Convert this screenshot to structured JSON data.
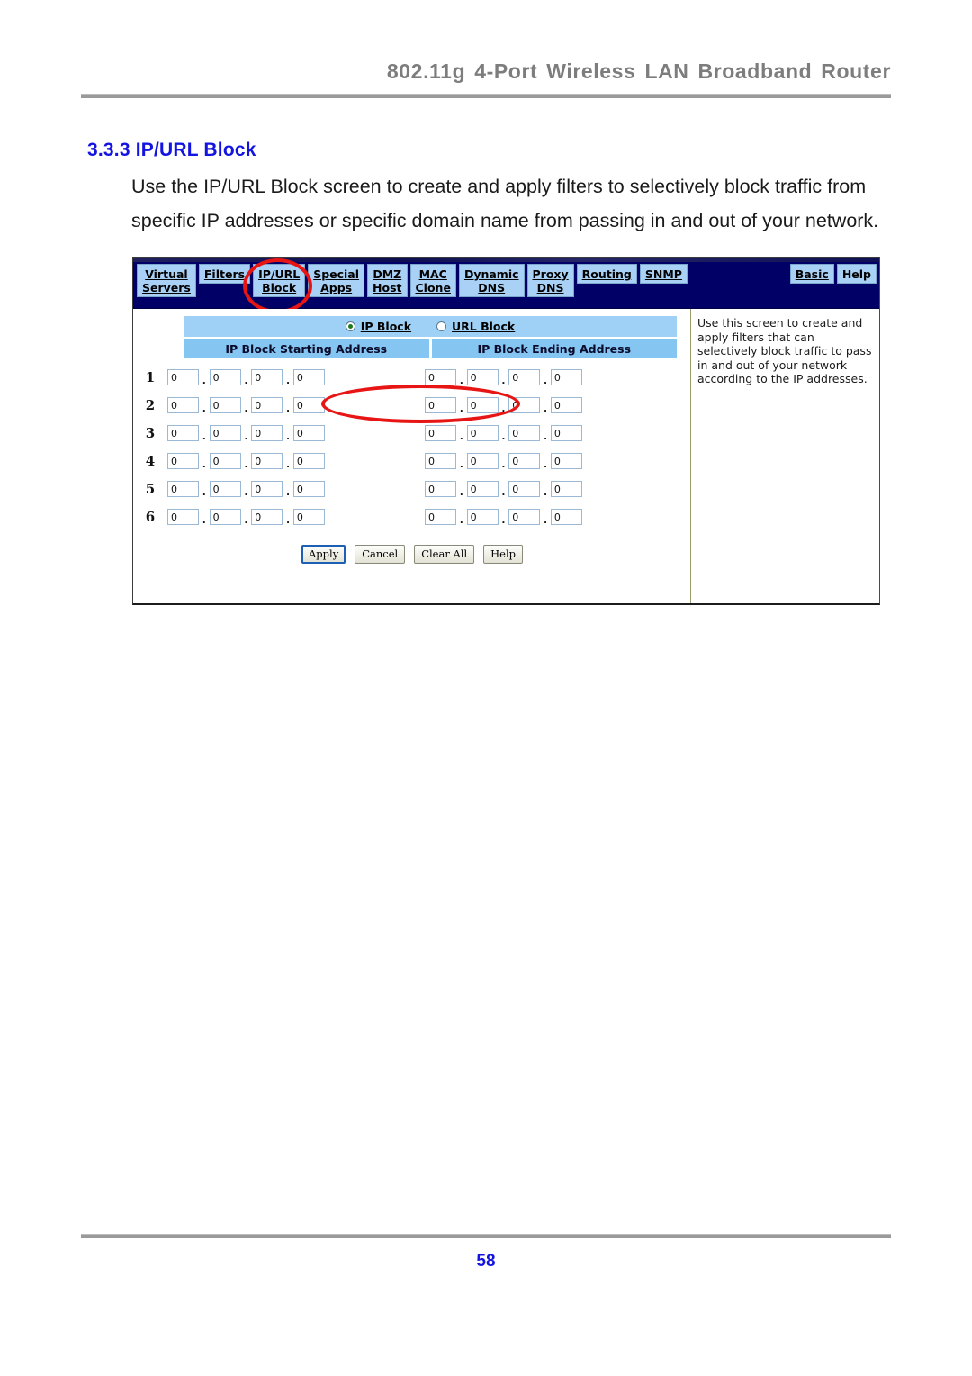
{
  "document": {
    "running_header": "802.11g 4-Port Wireless LAN Broadband Router",
    "section_number_title": "3.3.3 IP/URL Block",
    "body_paragraph": "Use the IP/URL Block screen to create and apply filters to selectively block traffic from specific IP addresses or specific domain name from passing in and out of your network.",
    "page_number": "58"
  },
  "screenshot": {
    "navbar": {
      "tabs": [
        {
          "id": "virtual-servers",
          "line1": "Virtual",
          "line2": "Servers"
        },
        {
          "id": "filters",
          "line1": "Filters",
          "line2": ""
        },
        {
          "id": "ip-url-block",
          "line1": "IP/URL",
          "line2": "Block"
        },
        {
          "id": "special-apps",
          "line1": "Special",
          "line2": "Apps"
        },
        {
          "id": "dmz-host",
          "line1": "DMZ",
          "line2": "Host"
        },
        {
          "id": "mac-clone",
          "line1": "MAC",
          "line2": "Clone"
        },
        {
          "id": "dynamic-dns",
          "line1": "Dynamic",
          "line2": "DNS"
        },
        {
          "id": "proxy-dns",
          "line1": "Proxy",
          "line2": "DNS"
        },
        {
          "id": "routing",
          "line1": "Routing",
          "line2": ""
        },
        {
          "id": "snmp",
          "line1": "SNMP",
          "line2": ""
        }
      ],
      "right_tabs": [
        {
          "id": "basic",
          "line1": "Basic",
          "line2": "",
          "underline": true
        },
        {
          "id": "help",
          "line1": "Help",
          "line2": "",
          "underline": false
        }
      ]
    },
    "mode_radios": {
      "selected": "IP Block",
      "options": [
        {
          "label": "IP Block",
          "checked": true
        },
        {
          "label": "URL Block",
          "checked": false
        }
      ]
    },
    "table": {
      "columns": [
        "IP Block Starting Address",
        "IP Block Ending Address"
      ],
      "rows": [
        {
          "num": "1",
          "start": [
            "0",
            "0",
            "0",
            "0"
          ],
          "end": [
            "0",
            "0",
            "0",
            "0"
          ]
        },
        {
          "num": "2",
          "start": [
            "0",
            "0",
            "0",
            "0"
          ],
          "end": [
            "0",
            "0",
            "0",
            "0"
          ]
        },
        {
          "num": "3",
          "start": [
            "0",
            "0",
            "0",
            "0"
          ],
          "end": [
            "0",
            "0",
            "0",
            "0"
          ]
        },
        {
          "num": "4",
          "start": [
            "0",
            "0",
            "0",
            "0"
          ],
          "end": [
            "0",
            "0",
            "0",
            "0"
          ]
        },
        {
          "num": "5",
          "start": [
            "0",
            "0",
            "0",
            "0"
          ],
          "end": [
            "0",
            "0",
            "0",
            "0"
          ]
        },
        {
          "num": "6",
          "start": [
            "0",
            "0",
            "0",
            "0"
          ],
          "end": [
            "0",
            "0",
            "0",
            "0"
          ]
        }
      ],
      "separator": "."
    },
    "buttons": [
      {
        "id": "apply",
        "label": "Apply",
        "primary": true
      },
      {
        "id": "cancel",
        "label": "Cancel",
        "primary": false
      },
      {
        "id": "clear-all",
        "label": "Clear All",
        "primary": false
      },
      {
        "id": "help",
        "label": "Help",
        "primary": false
      }
    ],
    "help_panel": {
      "text": "Use this screen to create and apply filters that can selectively block traffic to pass in and out of your network according to the IP addresses."
    },
    "annotations": [
      {
        "id": "tab-ellipse",
        "target": "IP/URL Block tab",
        "color": "#e81515"
      },
      {
        "id": "radio-ellipse",
        "target": "IP Block / URL Block radio row",
        "color": "#e81515"
      }
    ]
  },
  "colors": {
    "heading_blue": "#1414e0",
    "navbar_navy": "#000066",
    "tab_blue": "#a8d1f5",
    "row_header_blue": "#85c5f2",
    "radio_row_blue": "#9fd0f5",
    "annotation_red": "#e81515",
    "header_gray": "#7d7d7d"
  }
}
